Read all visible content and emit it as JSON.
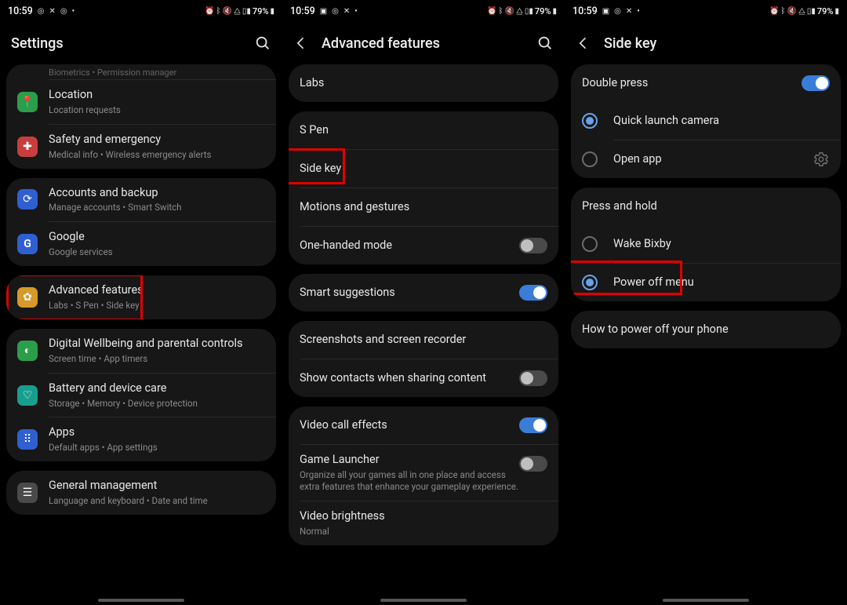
{
  "status": {
    "time": "10:59",
    "left_icons": [
      "instagram-icon",
      "compass-icon",
      "instagram-icon",
      "dot-icon"
    ],
    "left_icons_b": [
      "gallery-icon",
      "instagram-icon",
      "compass-icon",
      "dot-icon"
    ],
    "right_text": "79%",
    "right_icons": [
      "alarm-icon",
      "bluetooth-icon",
      "mute-icon",
      "wifi-icon",
      "signal-icon",
      "battery-icon"
    ]
  },
  "screen1": {
    "title": "Settings",
    "truncated_top": "Biometrics  •  Permission manager",
    "items": [
      {
        "icon_color": "#2b9e4a",
        "glyph": "📍",
        "title": "Location",
        "sub": "Location requests"
      },
      {
        "icon_color": "#c83e3e",
        "glyph": "⛑",
        "title": "Safety and emergency",
        "sub": "Medical info  •  Wireless emergency alerts"
      }
    ],
    "group2": [
      {
        "icon_color": "#2f5fd0",
        "glyph": "🔄",
        "title": "Accounts and backup",
        "sub": "Manage accounts  •  Smart Switch"
      },
      {
        "icon_color": "#2f5fd0",
        "glyph": "G",
        "title": "Google",
        "sub": "Google services"
      }
    ],
    "group3": [
      {
        "icon_color": "#d69a2a",
        "glyph": "⚙",
        "title": "Advanced features",
        "sub": "Labs  •  S Pen  •  Side key"
      }
    ],
    "group4": [
      {
        "icon_color": "#2b9e4a",
        "glyph": "◑",
        "title": "Digital Wellbeing and parental controls",
        "sub": "Screen time  •  App timers"
      },
      {
        "icon_color": "#189e8f",
        "glyph": "❤",
        "title": "Battery and device care",
        "sub": "Storage  •  Memory  •  Device protection"
      },
      {
        "icon_color": "#2f5fd0",
        "glyph": "⊞",
        "title": "Apps",
        "sub": "Default apps  •  App settings"
      }
    ],
    "group5": [
      {
        "icon_color": "#4a4a4a",
        "glyph": "≡",
        "title": "General management",
        "sub": "Language and keyboard  •  Date and time"
      }
    ]
  },
  "screen2": {
    "title": "Advanced features",
    "g1": [
      {
        "title": "Labs"
      }
    ],
    "g2": [
      {
        "title": "S Pen"
      },
      {
        "title": "Side key"
      },
      {
        "title": "Motions and gestures"
      },
      {
        "title": "One-handed mode",
        "toggle": "off"
      }
    ],
    "g3": [
      {
        "title": "Smart suggestions",
        "toggle": "on"
      }
    ],
    "g4": [
      {
        "title": "Screenshots and screen recorder"
      },
      {
        "title": "Show contacts when sharing content",
        "toggle": "off"
      }
    ],
    "g5": [
      {
        "title": "Video call effects",
        "toggle": "on"
      },
      {
        "title": "Game Launcher",
        "sub": "Organize all your games all in one place and access extra features that enhance your gameplay experience.",
        "toggle": "off"
      },
      {
        "title": "Video brightness",
        "sub": "Normal"
      }
    ]
  },
  "screen3": {
    "title": "Side key",
    "section1_title": "Double press",
    "section1_toggle": "on",
    "section1_opts": [
      {
        "label": "Quick launch camera",
        "checked": true
      },
      {
        "label": "Open app",
        "checked": false,
        "gear": true
      }
    ],
    "section2_title": "Press and hold",
    "section2_opts": [
      {
        "label": "Wake Bixby",
        "checked": false
      },
      {
        "label": "Power off menu",
        "checked": true
      }
    ],
    "link": "How to power off your phone"
  }
}
